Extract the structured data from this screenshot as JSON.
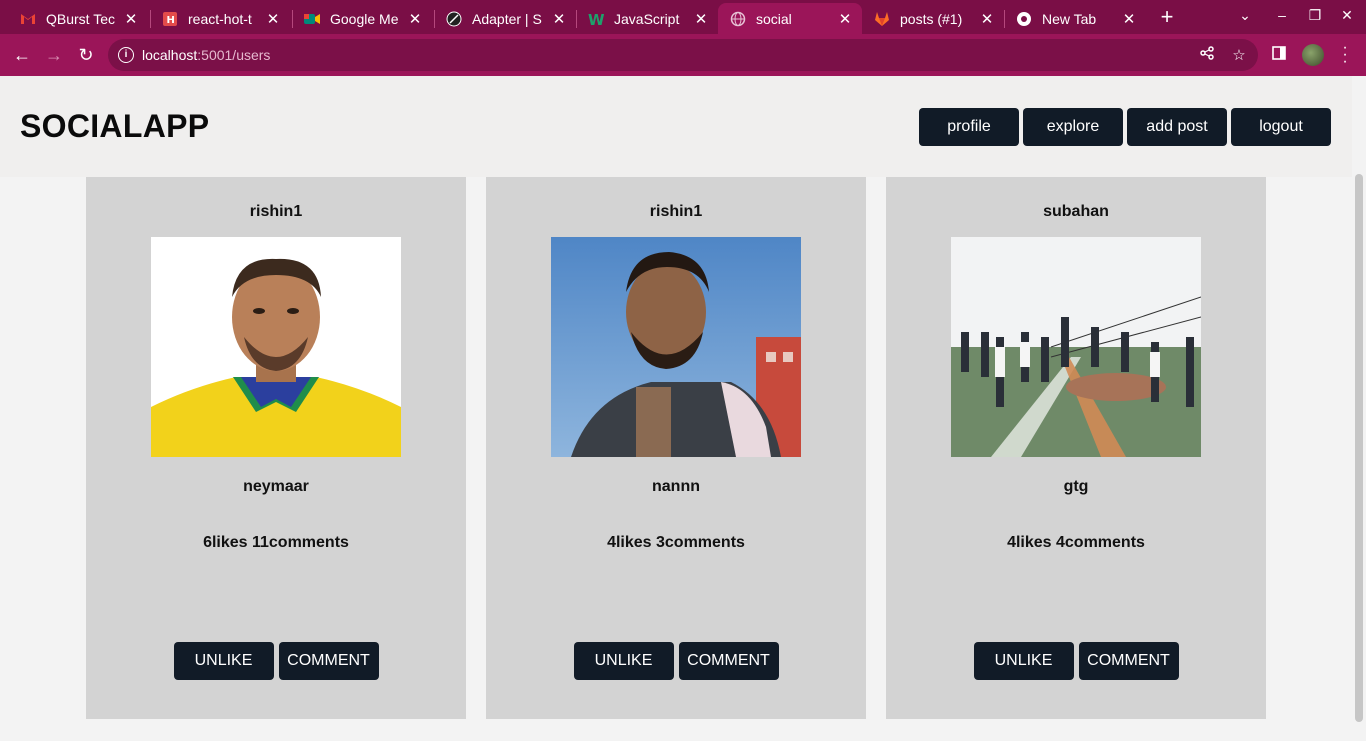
{
  "browser": {
    "tabs": [
      {
        "title": "QBurst Tec",
        "icon": "gmail-icon"
      },
      {
        "title": "react-hot-t",
        "icon": "h-logo-icon"
      },
      {
        "title": "Google Me",
        "icon": "meet-icon"
      },
      {
        "title": "Adapter | S",
        "icon": "compass-icon"
      },
      {
        "title": "JavaScript",
        "icon": "w-logo-icon"
      },
      {
        "title": "social",
        "icon": "globe-icon",
        "active": true
      },
      {
        "title": "posts (#1)",
        "icon": "gitlab-icon"
      },
      {
        "title": "New Tab",
        "icon": "chrome-icon"
      }
    ],
    "url_host": "localhost",
    "url_path": ":5001/users"
  },
  "app": {
    "brand": "SOCIALAPP",
    "nav": {
      "profile": "profile",
      "explore": "explore",
      "add_post": "add post",
      "logout": "logout"
    }
  },
  "posts": [
    {
      "user": "rishin1",
      "caption": "neymaar",
      "stats": "6likes 11comments",
      "like_label": "UNLIKE",
      "comment_label": "COMMENT"
    },
    {
      "user": "rishin1",
      "caption": "nannn",
      "stats": "4likes 3comments",
      "like_label": "UNLIKE",
      "comment_label": "COMMENT"
    },
    {
      "user": "subahan",
      "caption": "gtg",
      "stats": "4likes 4comments",
      "like_label": "UNLIKE",
      "comment_label": "COMMENT"
    }
  ],
  "colors": {
    "tabbar": "#7a0e46",
    "toolbar": "#9b1559",
    "button": "#111b27",
    "card": "#d3d3d3"
  }
}
